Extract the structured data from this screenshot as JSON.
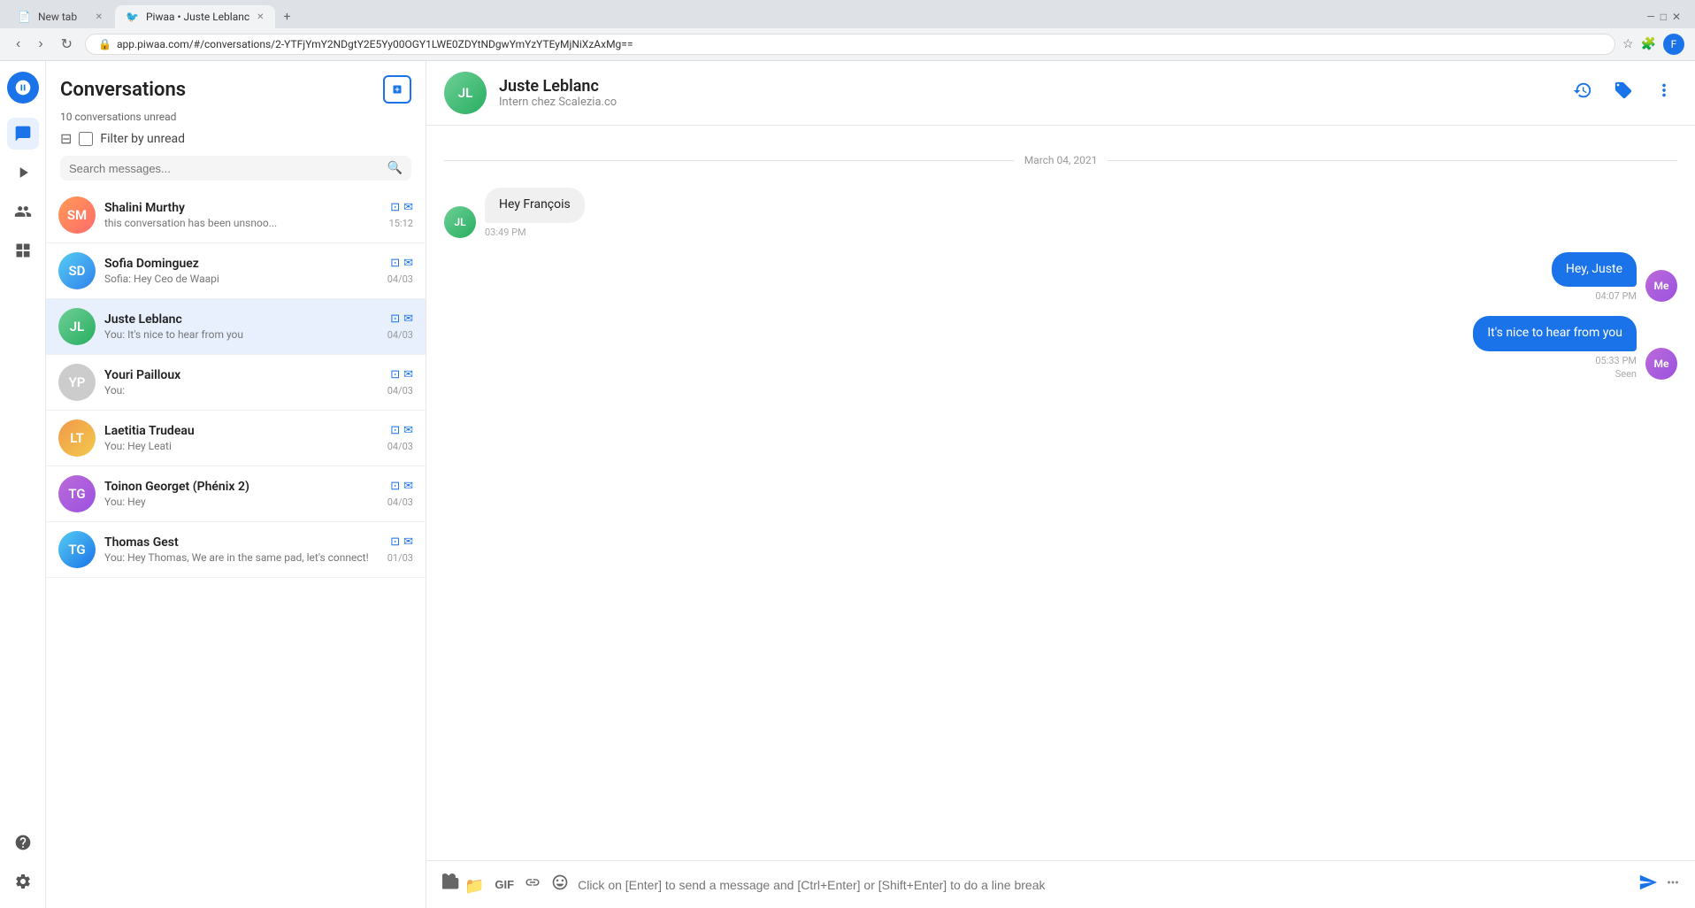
{
  "browser": {
    "tabs": [
      {
        "label": "New tab",
        "active": false,
        "favicon": "📄"
      },
      {
        "label": "Piwaa • Juste Leblanc",
        "active": true,
        "favicon": "🐦"
      }
    ],
    "url": "app.piwaa.com/#/conversations/2-YTFjYmY2NDgtY2E5Yy00OGY1LWE0ZDYtNDgwYmYzYTEyMjNiXzAxMg=="
  },
  "sidebar": {
    "logo_alt": "Piwaa logo",
    "icons": [
      {
        "name": "chat-icon",
        "symbol": "💬",
        "active": true
      },
      {
        "name": "play-icon",
        "symbol": "▶"
      },
      {
        "name": "people-icon",
        "symbol": "👥"
      },
      {
        "name": "grid-icon",
        "symbol": "⊞"
      },
      {
        "name": "help-icon",
        "symbol": "?"
      },
      {
        "name": "settings-icon",
        "symbol": "⚙"
      }
    ]
  },
  "conversations_panel": {
    "title": "Conversations",
    "new_button_label": "+",
    "unread_text": "10 conversations unread",
    "filter_label": "Filter by unread",
    "search_placeholder": "Search messages...",
    "items": [
      {
        "id": 1,
        "name": "Shalini Murthy",
        "preview": "this conversation has been unsnoo...",
        "time": "15:12",
        "initials": "SM",
        "avatar_class": "av-shalini",
        "has_icons": true,
        "active": false
      },
      {
        "id": 2,
        "name": "Sofia Dominguez",
        "preview": "Sofia: Hey Ceo de Waapi",
        "time": "04/03",
        "initials": "SD",
        "avatar_class": "av-sofia",
        "has_icons": true,
        "active": false
      },
      {
        "id": 3,
        "name": "Juste Leblanc",
        "preview": "You: It's nice to hear from you",
        "time": "04/03",
        "initials": "JL",
        "avatar_class": "av-juste",
        "has_icons": true,
        "active": true
      },
      {
        "id": 4,
        "name": "Youri Pailloux",
        "preview": "You:",
        "time": "04/03",
        "initials": "YP",
        "avatar_class": "av-youri",
        "has_icons": true,
        "active": false
      },
      {
        "id": 5,
        "name": "Laetitia Trudeau",
        "preview": "You: Hey Leati",
        "time": "04/03",
        "initials": "LT",
        "avatar_class": "av-laetitia",
        "has_icons": true,
        "active": false
      },
      {
        "id": 6,
        "name": "Toinon Georget (Phénix 2)",
        "preview": "You: Hey",
        "time": "04/03",
        "initials": "TG",
        "avatar_class": "av-toinon",
        "has_icons": true,
        "active": false
      },
      {
        "id": 7,
        "name": "Thomas Gest",
        "preview": "You: Hey Thomas, We are in the same pad, let's connect!",
        "time": "01/03",
        "initials": "TG",
        "avatar_class": "av-thomas",
        "has_icons": true,
        "active": false
      }
    ]
  },
  "chat": {
    "contact_name": "Juste Leblanc",
    "contact_subtitle": "Intern chez Scalezia.co",
    "contact_initials": "JL",
    "date_divider": "March 04, 2021",
    "messages": [
      {
        "id": 1,
        "type": "incoming",
        "text": "Hey François",
        "time": "03:49 PM",
        "sender_initials": "JL"
      },
      {
        "id": 2,
        "type": "outgoing",
        "text": "Hey, Juste",
        "time": "04:07 PM",
        "sender_initials": "Me"
      },
      {
        "id": 3,
        "type": "outgoing",
        "text": "It's nice to hear from you",
        "time": "05:33 PM",
        "sender_initials": "Me",
        "seen": "Seen"
      }
    ],
    "input_placeholder": "Click on [Enter] to send a message and [Ctrl+Enter] or [Shift+Enter] to do a line break",
    "input_tools": [
      {
        "name": "folder-icon",
        "symbol": "📁"
      },
      {
        "name": "gif-icon",
        "label": "GIF"
      },
      {
        "name": "link-icon",
        "symbol": "🔗"
      },
      {
        "name": "emoji-icon",
        "symbol": "😊"
      }
    ]
  }
}
